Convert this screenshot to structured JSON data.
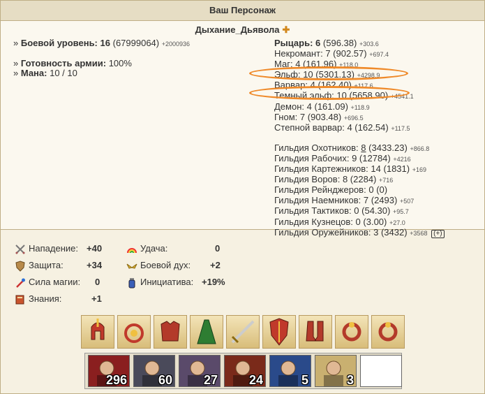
{
  "header": {
    "title": "Ваш Персонаж"
  },
  "character": {
    "name": "Дыхание_Дьявола",
    "faction_icon": "cross-icon"
  },
  "left": {
    "combat_level_label": "Боевой уровень:",
    "combat_level_value": "16",
    "combat_exp": "(67999064)",
    "combat_exp_delta": "+2000936",
    "army_label": "Готовность армии:",
    "army_value": "100%",
    "mana_label": "Мана:",
    "mana_value": "10 / 10"
  },
  "factions": [
    {
      "name": "Рыцарь:",
      "level": "6",
      "exp": "(596.38)",
      "delta": "+303.6",
      "bold": true
    },
    {
      "name": "Некромант:",
      "level": "7",
      "exp": "(902.57)",
      "delta": "+697.4"
    },
    {
      "name": "Маг:",
      "level": "4",
      "exp": "(161.96)",
      "delta": "+118.0"
    },
    {
      "name": "Эльф:",
      "level": "10",
      "exp": "(5301.13)",
      "delta": "+4298.9"
    },
    {
      "name": "Варвар:",
      "level": "4",
      "exp": "(162.40)",
      "delta": "+117.6"
    },
    {
      "name": "Темный эльф:",
      "level": "10",
      "exp": "(5658.90)",
      "delta": "+4541.1"
    },
    {
      "name": "Демон:",
      "level": "4",
      "exp": "(161.09)",
      "delta": "+118.9"
    },
    {
      "name": "Гном:",
      "level": "7",
      "exp": "(903.48)",
      "delta": "+696.5"
    },
    {
      "name": "Степной варвар:",
      "level": "4",
      "exp": "(162.54)",
      "delta": "+117.5"
    }
  ],
  "guilds": [
    {
      "name": "Гильдия Охотников:",
      "level": "8",
      "exp": "(3433.23)",
      "delta": "+866.8",
      "underline": true
    },
    {
      "name": "Гильдия Рабочих:",
      "level": "9",
      "exp": "(12784)",
      "delta": "+4216"
    },
    {
      "name": "Гильдия Картежников:",
      "level": "14",
      "exp": "(1831)",
      "delta": "+169"
    },
    {
      "name": "Гильдия Воров:",
      "level": "8",
      "exp": "(2284)",
      "delta": "+716"
    },
    {
      "name": "Гильдия Рейнджеров:",
      "level": "0",
      "exp": "(0)",
      "delta": ""
    },
    {
      "name": "Гильдия Наемников:",
      "level": "7",
      "exp": "(2493)",
      "delta": "+507"
    },
    {
      "name": "Гильдия Тактиков:",
      "level": "0",
      "exp": "(54.30)",
      "delta": "+95.7"
    },
    {
      "name": "Гильдия Кузнецов:",
      "level": "0",
      "exp": "(3.00)",
      "delta": "+27.0"
    },
    {
      "name": "Гильдия Оружейников:",
      "level": "3",
      "exp": "(3432)",
      "delta": "+3568",
      "plus": "(+)"
    }
  ],
  "stats": [
    {
      "label": "Нападение:",
      "value": "+40",
      "icon": "swords-icon"
    },
    {
      "label": "Защита:",
      "value": "+34",
      "icon": "shield-icon"
    },
    {
      "label": "Сила магии:",
      "value": "0",
      "icon": "wand-icon"
    },
    {
      "label": "Знания:",
      "value": "+1",
      "icon": "book-icon"
    },
    {
      "label": "Удача:",
      "value": "0",
      "icon": "rainbow-icon"
    },
    {
      "label": "Боевой дух:",
      "value": "+2",
      "icon": "wings-icon"
    },
    {
      "label": "Инициатива:",
      "value": "+19%",
      "icon": "potion-icon"
    }
  ],
  "equipment": [
    "helmet-icon",
    "amulet-icon",
    "armor-icon",
    "cloak-icon",
    "sword-icon",
    "shield-icon",
    "boots-icon",
    "ring-icon",
    "ring-icon"
  ],
  "units": [
    {
      "count": "296",
      "icon": "peasant-unit-icon"
    },
    {
      "count": "60",
      "icon": "footman-unit-icon"
    },
    {
      "count": "27",
      "icon": "griffin-unit-icon"
    },
    {
      "count": "24",
      "icon": "priest-unit-icon"
    },
    {
      "count": "5",
      "icon": "cavalier-unit-icon"
    },
    {
      "count": "3",
      "icon": "angel-unit-icon"
    },
    {
      "count": "",
      "icon": "empty-slot"
    }
  ]
}
